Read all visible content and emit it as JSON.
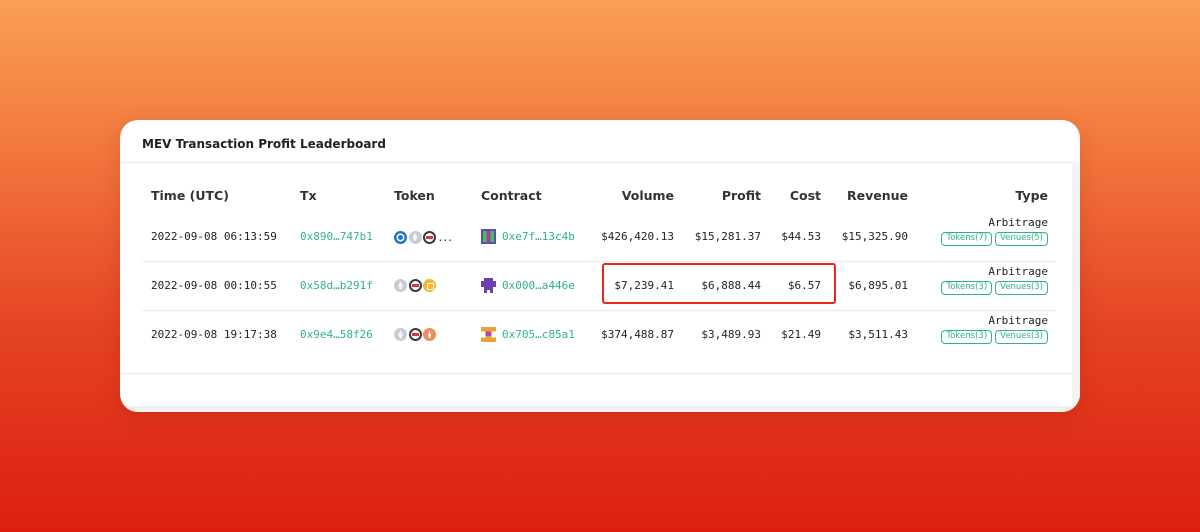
{
  "card": {
    "title": "MEV Transaction Profit Leaderboard"
  },
  "columns": {
    "time": "Time (UTC)",
    "tx": "Tx",
    "token": "Token",
    "contract": "Contract",
    "volume": "Volume",
    "profit": "Profit",
    "cost": "Cost",
    "revenue": "Revenue",
    "type": "Type"
  },
  "rows": [
    {
      "time": "2022-09-08 06:13:59",
      "tx": "0x890…747b1",
      "tokens": [
        "usdc-icon",
        "eth-icon",
        "dark-token-icon"
      ],
      "more": "...",
      "contract": "0xe7f…13c4b",
      "volume": "$426,420.13",
      "profit": "$15,281.37",
      "cost": "$44.53",
      "revenue": "$15,325.90",
      "type": "Arbitrage",
      "tags": [
        "Tokens(7)",
        "Venues(5)"
      ]
    },
    {
      "time": "2022-09-08 00:10:55",
      "tx": "0x58d…b291f",
      "tokens": [
        "eth-icon",
        "dark-token-icon",
        "yellow-token-icon"
      ],
      "contract": "0x000…a446e",
      "volume": "$7,239.41",
      "profit": "$6,888.44",
      "cost": "$6.57",
      "revenue": "$6,895.01",
      "type": "Arbitrage",
      "tags": [
        "Tokens(3)",
        "Venues(3)"
      ]
    },
    {
      "time": "2022-09-08 19:17:38",
      "tx": "0x9e4…58f26",
      "tokens": [
        "eth-icon",
        "dark-token-icon",
        "orange-token-icon"
      ],
      "contract": "0x705…c85a1",
      "volume": "$374,488.87",
      "profit": "$3,489.93",
      "cost": "$21.49",
      "revenue": "$3,511.43",
      "type": "Arbitrage",
      "tags": [
        "Tokens(3)",
        "Venues(3)"
      ]
    }
  ],
  "colors": {
    "accent_green": "#2db28a",
    "highlight_red": "#e5281a"
  }
}
